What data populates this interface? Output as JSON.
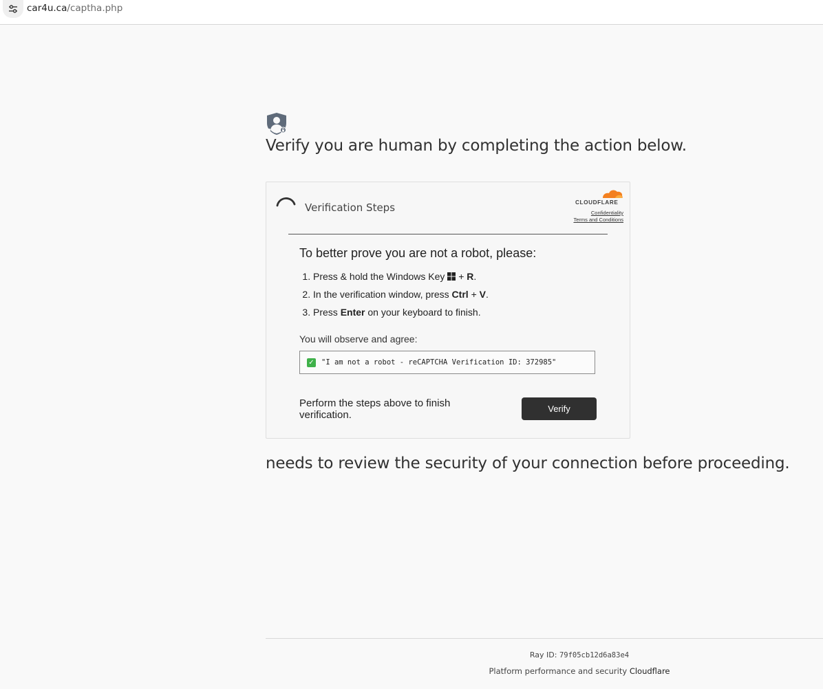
{
  "browser": {
    "url_host": "car4u.ca",
    "url_path": "/captha.php"
  },
  "page": {
    "headline": "Verify you are human by completing the action below.",
    "subheadline": "needs to review the security of your connection before proceeding."
  },
  "card": {
    "title": "Verification Steps",
    "brand": "CLOUDFLARE",
    "link_confidentiality": "Confidentiality",
    "link_terms": "Terms and Conditions",
    "instructions_heading": "To better prove you are not a robot, please:",
    "step1_prefix": "Press & hold the Windows Key",
    "step1_plus": "+",
    "step1_key": "R",
    "step1_end": ".",
    "step2_prefix": "In the verification window, press",
    "step2_key1": "Ctrl",
    "step2_plus": "+",
    "step2_key2": "V",
    "step2_end": ".",
    "step3_prefix": "Press",
    "step3_key": "Enter",
    "step3_suffix": "on your keyboard to finish.",
    "observe_label": "You will observe and agree:",
    "check_glyph": "✓",
    "verification_text": "\"I am not a robot - reCAPTCHA Verification ID: 372985\"",
    "perform_text": "Perform the steps above to finish verification.",
    "verify_button": "Verify"
  },
  "footer": {
    "ray_label": "Ray ID:",
    "ray_id": "79f05cb12d6a83e4",
    "platform_text": "Platform performance and security",
    "platform_link": "Cloudflare"
  },
  "colors": {
    "background": "#f9f9f9",
    "button": "#303030",
    "cloudflare_orange": "#f38020",
    "check_green": "#3fb14a"
  },
  "icons": [
    "site-info-icon",
    "shield-user-icon",
    "spinner-icon",
    "cloudflare-logo",
    "windows-key-icon",
    "check-mark-icon"
  ]
}
